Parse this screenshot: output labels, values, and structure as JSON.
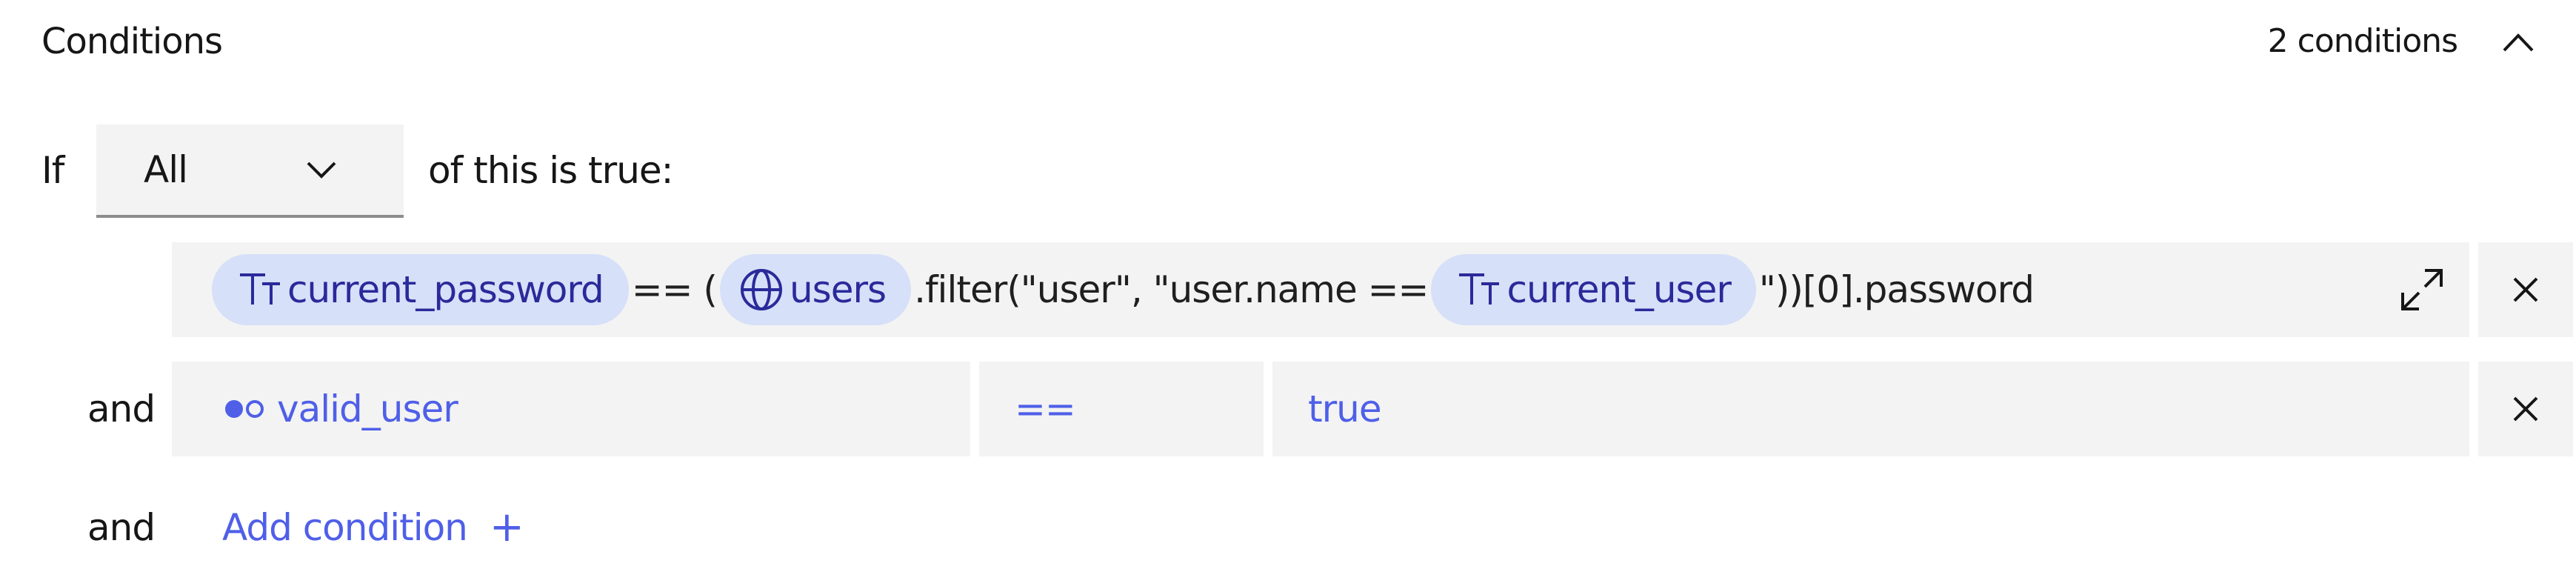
{
  "header": {
    "title": "Conditions",
    "count_label": "2 conditions",
    "collapse_icon": "chevron-up-icon"
  },
  "match": {
    "prefix": "If",
    "selected": "All",
    "suffix": "of this is true:"
  },
  "conditions": [
    {
      "connector": "",
      "type": "expression",
      "parts": [
        {
          "kind": "variable",
          "icon": "text-type-icon",
          "label": "current_password"
        },
        {
          "kind": "text",
          "label": "== ("
        },
        {
          "kind": "variable",
          "icon": "globe-icon",
          "label": "users"
        },
        {
          "kind": "text",
          "label": ".filter(\"user\", \"user.name =="
        },
        {
          "kind": "variable",
          "icon": "text-type-icon",
          "label": "current_user"
        },
        {
          "kind": "text",
          "label": "\"))[0].password"
        }
      ],
      "expand_icon": "expand-icon",
      "remove_icon": "close-icon"
    },
    {
      "connector": "and",
      "type": "simple",
      "left": {
        "icon": "boolean-icon",
        "label": "valid_user"
      },
      "operator": "==",
      "right": "true",
      "remove_icon": "close-icon"
    }
  ],
  "add": {
    "connector": "and",
    "label": "Add condition",
    "icon": "+"
  },
  "colors": {
    "accent": "#4f5fe8",
    "pill_bg": "#d6e0f8",
    "pill_text": "#2a2a9a",
    "field_bg": "#f3f3f3"
  }
}
